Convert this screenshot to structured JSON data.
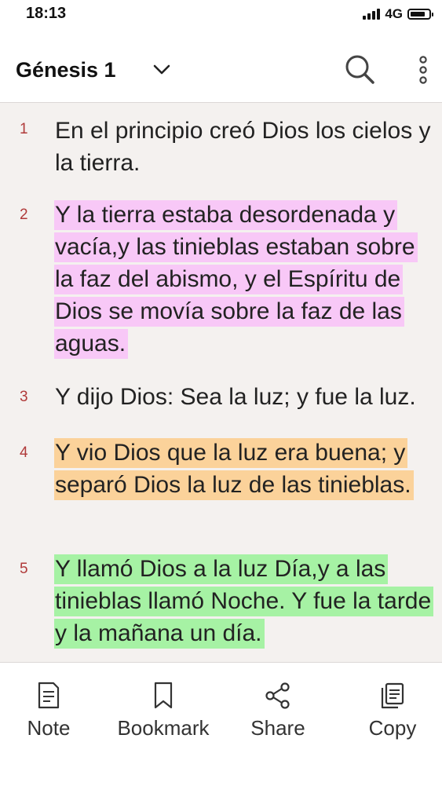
{
  "status": {
    "time": "18:13",
    "network": "4G"
  },
  "header": {
    "title": "Génesis 1"
  },
  "colors": {
    "pink": "#f8c8f7",
    "orange": "#fbd29a",
    "green": "#a6f2a4",
    "verse_number": "#b03a3a"
  },
  "verses": [
    {
      "num": "1",
      "text": "En el principio creó Dios los cielos y la tierra.",
      "highlight": "none"
    },
    {
      "num": "2",
      "text": "Y la tierra estaba desordenada y vacía,y las tinieblas estaban sobre la faz del abismo, y el Espíritu de Dios se movía sobre la faz de las aguas.",
      "highlight": "pink"
    },
    {
      "num": "3",
      "text": "Y dijo Dios: Sea la luz; y fue la luz.",
      "highlight": "none"
    },
    {
      "num": "4",
      "text": "Y vio Dios que la luz era buena; y separó Dios la luz de las tinieblas.",
      "highlight": "orange"
    },
    {
      "num": "5",
      "text": "Y llamó Dios a la luz Día,y a las tinieblas llamó Noche. Y fue la tarde y la mañana un día.",
      "highlight": "green"
    }
  ],
  "actions": [
    {
      "label": "Note",
      "icon": "note-icon"
    },
    {
      "label": "Bookmark",
      "icon": "bookmark-icon"
    },
    {
      "label": "Share",
      "icon": "share-icon"
    },
    {
      "label": "Copy",
      "icon": "copy-icon"
    }
  ]
}
